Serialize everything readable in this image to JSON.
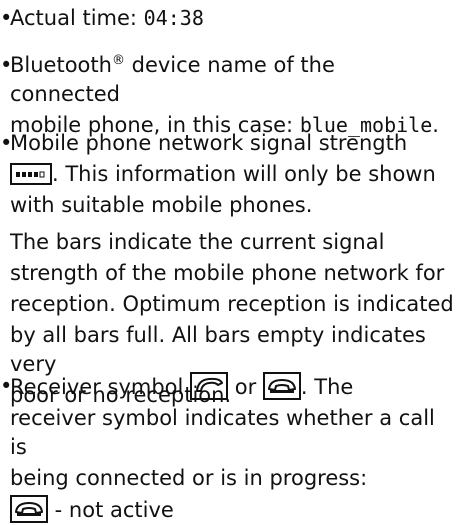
{
  "bullet_char": "•",
  "item1": {
    "text_before": "Actual time: ",
    "time_value": "04:38"
  },
  "item2": {
    "line1": "Bluetooth",
    "reg_mark": "®",
    "line1_rest": " device name of the connected",
    "line2_before": "mobile phone, in this case: ",
    "device_name": "blue_mobile",
    "line2_after": "."
  },
  "item3": {
    "line1": "Mobile phone network signal strength",
    "line2_after_icon": ". This information will only be shown",
    "line3": "with suitable mobile phones.",
    "signal_icon": "signal-strength-icon",
    "para_lines": [
      "The bars indicate the current signal",
      "strength of the mobile phone network for",
      "reception. Optimum reception is indicated",
      "by all bars full. All bars empty indicates very",
      "poor or no reception."
    ]
  },
  "item4": {
    "line1_before": "Receiver symbol ",
    "or_text": " or ",
    "line1_after": ". The",
    "line2": "receiver symbol indicates whether a call is",
    "line3": "being connected or is in progress:",
    "line4_after": " - not active",
    "icons": [
      "receiver-lifted-icon",
      "receiver-down-icon"
    ]
  }
}
